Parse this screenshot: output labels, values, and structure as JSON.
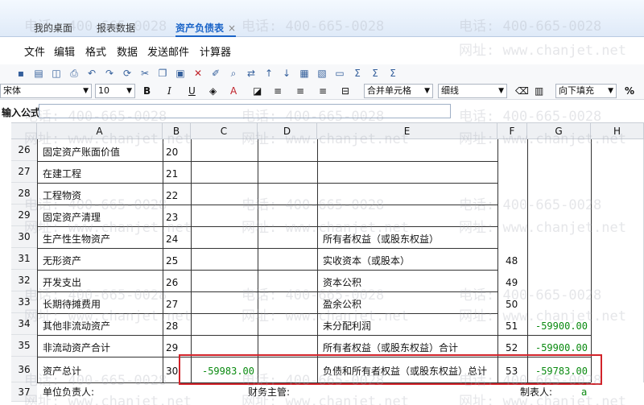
{
  "tabs": [
    {
      "label": "我的桌面"
    },
    {
      "label": "报表数据"
    },
    {
      "label": "资产负债表",
      "close": "×"
    }
  ],
  "menu": [
    "文件",
    "编辑",
    "格式",
    "数据",
    "发送邮件",
    "计算器"
  ],
  "toolbar": {
    "font": "宋体",
    "size": "10",
    "bold": "B",
    "italic": "I",
    "underline": "U",
    "merge": "合并单元格",
    "border": "细线",
    "fill": "向下填充",
    "percent": "%"
  },
  "formula_label": "输入公式：",
  "columns": [
    "A",
    "B",
    "C",
    "D",
    "E",
    "F",
    "G",
    "H"
  ],
  "rows": [
    {
      "n": "26",
      "a": "固定资产账面价值",
      "b": "20",
      "c": "",
      "e": "",
      "f": "",
      "g": ""
    },
    {
      "n": "27",
      "a": "在建工程",
      "b": "21",
      "c": "",
      "e": "",
      "f": "",
      "g": ""
    },
    {
      "n": "28",
      "a": "工程物资",
      "b": "22",
      "c": "",
      "e": "",
      "f": "",
      "g": ""
    },
    {
      "n": "29",
      "a": "固定资产清理",
      "b": "23",
      "c": "",
      "e": "",
      "f": "",
      "g": ""
    },
    {
      "n": "30",
      "a": "生产性生物资产",
      "b": "24",
      "c": "",
      "e": "所有者权益（或股东权益）",
      "f": "",
      "g": ""
    },
    {
      "n": "31",
      "a": "无形资产",
      "b": "25",
      "c": "",
      "e": "实收资本（或股本）",
      "f": "48",
      "g": ""
    },
    {
      "n": "32",
      "a": "开发支出",
      "b": "26",
      "c": "",
      "e": "资本公积",
      "f": "49",
      "g": ""
    },
    {
      "n": "33",
      "a": "长期待摊费用",
      "b": "27",
      "c": "",
      "e": "盈余公积",
      "f": "50",
      "g": ""
    },
    {
      "n": "34",
      "a": "其他非流动资产",
      "b": "28",
      "c": "",
      "e": "未分配利润",
      "f": "51",
      "g": "-59900.00"
    },
    {
      "n": "35",
      "a": "非流动资产合计",
      "b": "29",
      "c": "",
      "e": "所有者权益（或股东权益）合计",
      "f": "52",
      "g": "-59900.00"
    },
    {
      "n": "36",
      "a": "资产总计",
      "b": "30",
      "c": "-59983.00",
      "e": "负债和所有者权益（或股东权益）总计",
      "f": "53",
      "g": "-59783.00"
    }
  ],
  "footer": {
    "n": "37",
    "a": "单位负责人:",
    "d": "财务主管:",
    "g_label": "制表人:",
    "h": "a"
  },
  "watermark": {
    "phone": "电话: 400-665-0028",
    "site": "网址: www.chanjet.net"
  }
}
